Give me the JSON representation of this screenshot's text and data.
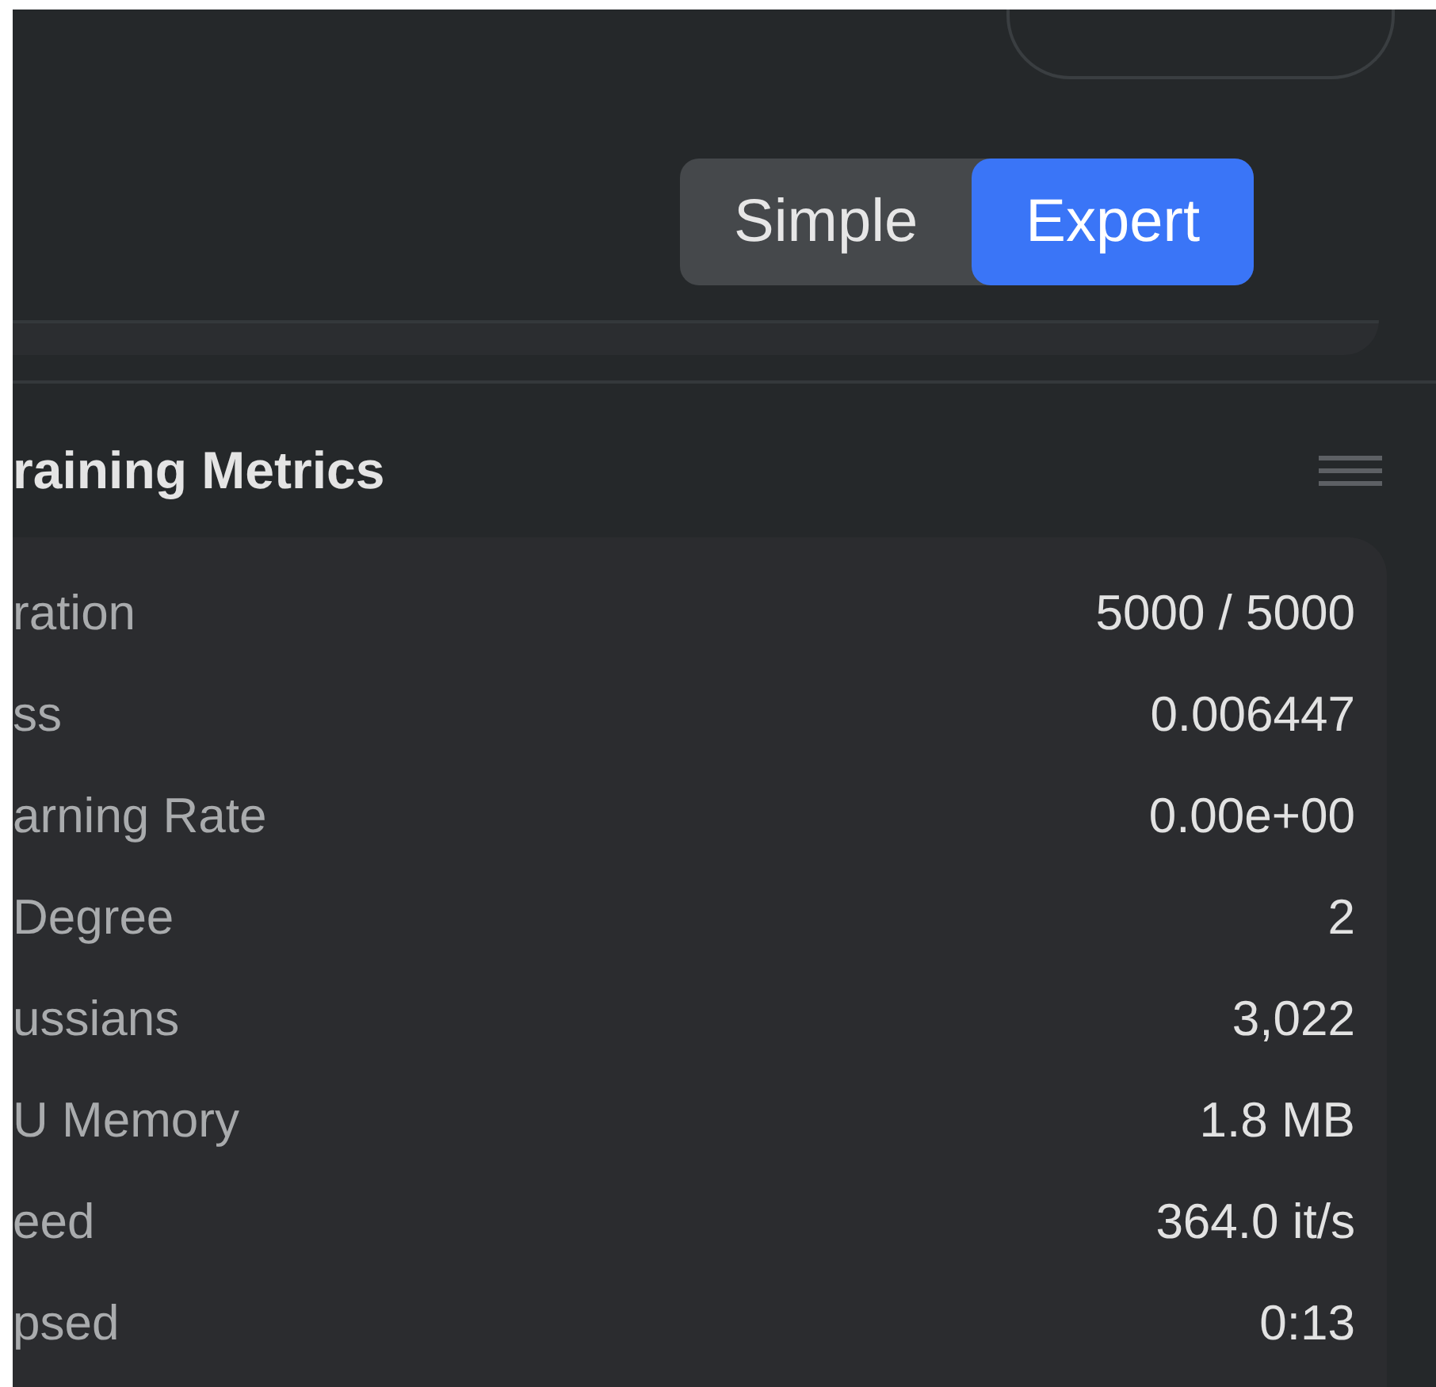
{
  "mode_toggle": [
    {
      "label": "Simple",
      "selected": false
    },
    {
      "label": "Expert",
      "selected": true
    }
  ],
  "metrics_panel": {
    "title": "raining Metrics",
    "rows": [
      {
        "label": "ration",
        "value": "5000 / 5000"
      },
      {
        "label": "ss",
        "value": "0.006447"
      },
      {
        "label": "arning Rate",
        "value": "0.00e+00"
      },
      {
        "label": "Degree",
        "value": "2"
      },
      {
        "label": "ussians",
        "value": "3,022"
      },
      {
        "label": "U Memory",
        "value": "1.8 MB"
      },
      {
        "label": "eed",
        "value": "364.0 it/s"
      },
      {
        "label": "psed",
        "value": "0:13"
      }
    ]
  }
}
